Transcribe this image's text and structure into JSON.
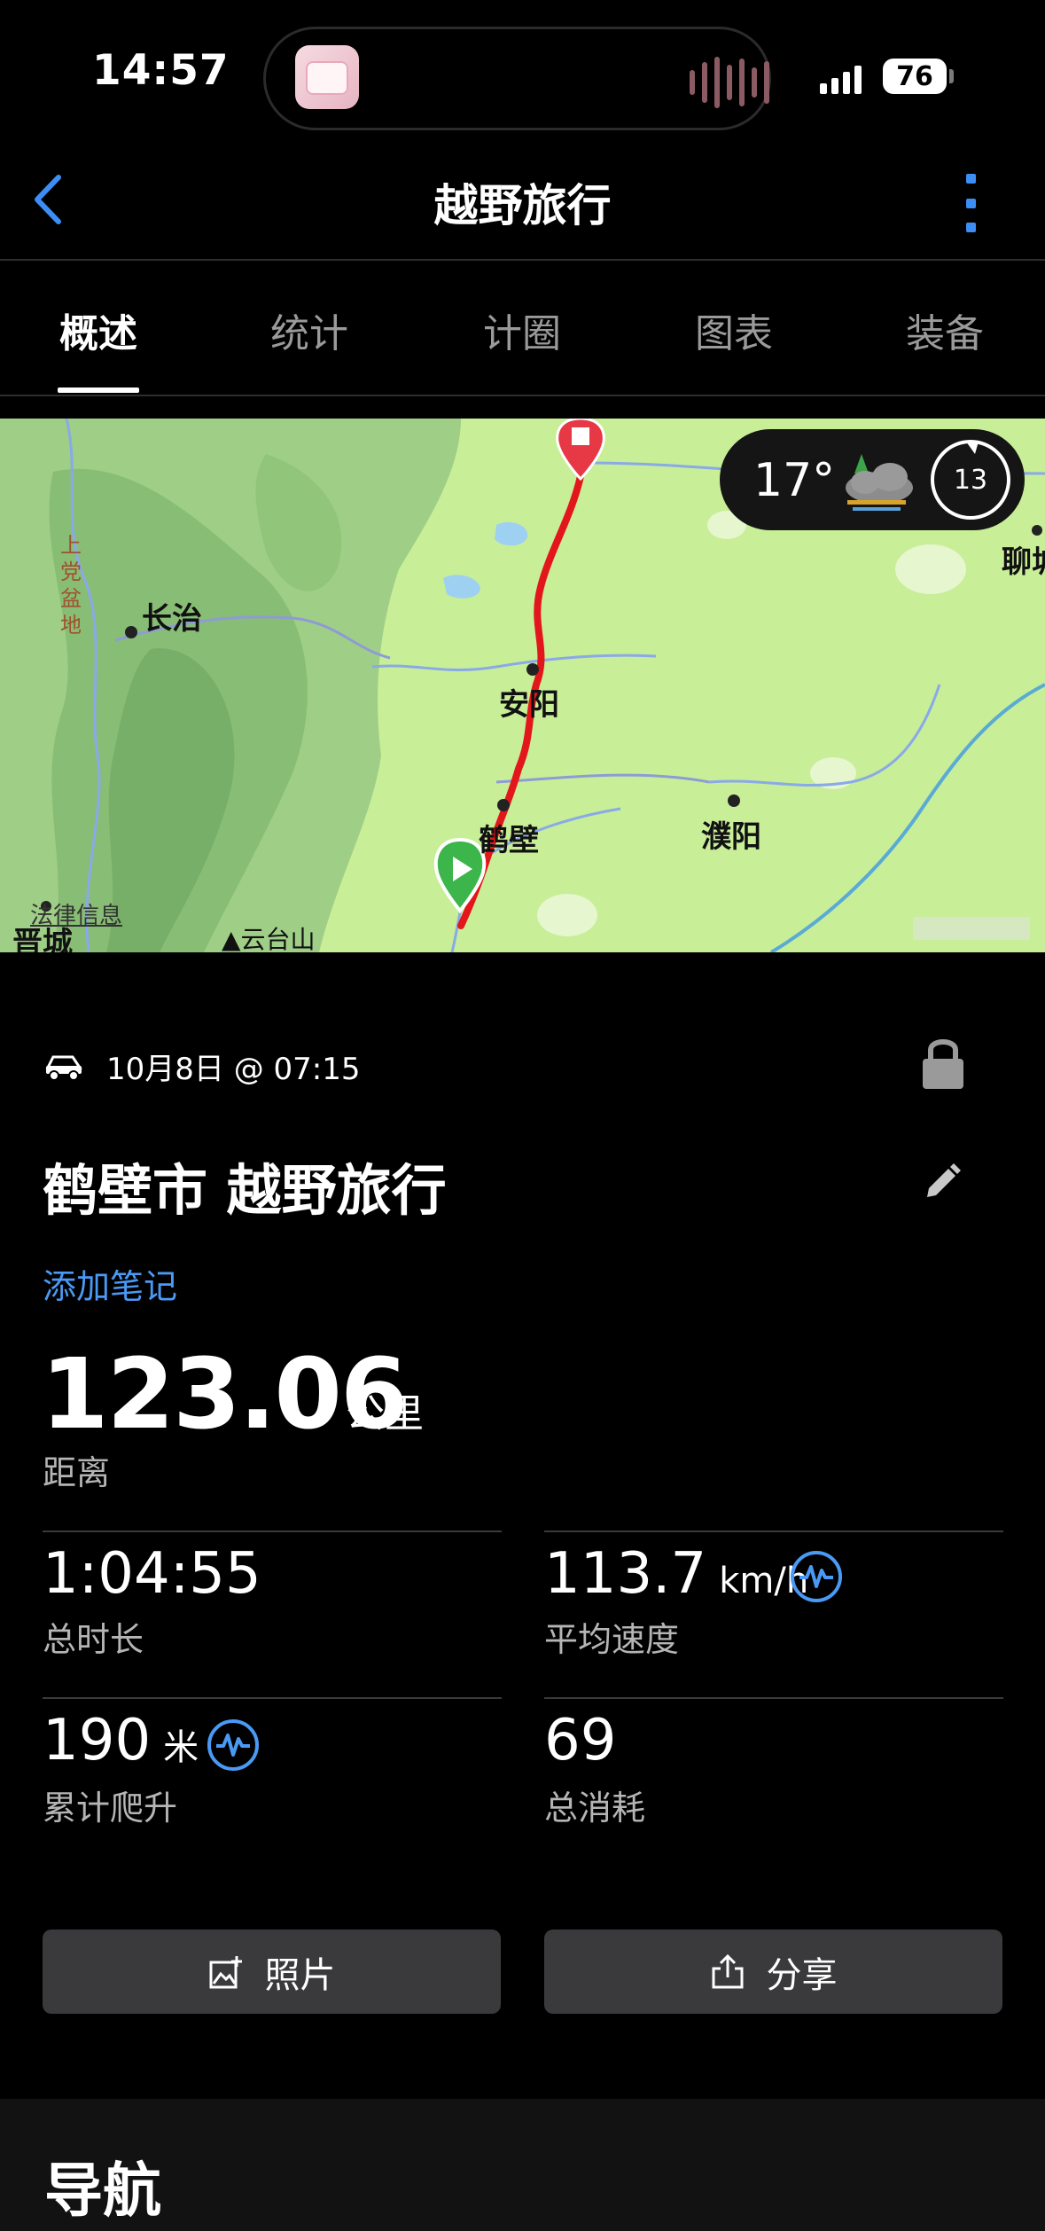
{
  "status_bar": {
    "time": "14:57",
    "battery": "76"
  },
  "header": {
    "title": "越野旅行"
  },
  "tabs": [
    {
      "label": "概述",
      "active": true
    },
    {
      "label": "统计",
      "active": false
    },
    {
      "label": "计圈",
      "active": false
    },
    {
      "label": "图表",
      "active": false
    },
    {
      "label": "装备",
      "active": false
    }
  ],
  "map": {
    "labels": {
      "changzhi": "长治",
      "anyang": "安阳",
      "hebi": "鹤壁",
      "puyang": "濮阳",
      "jincheng": "晋城",
      "yuntaishan": "云台山",
      "liaocheng": "聊城",
      "shangdang": "上党盆地",
      "info": "法律信息"
    },
    "weather": {
      "temp": "17°",
      "dial": "13"
    },
    "route_color": "#e3161b",
    "start_color": "#3cb54a",
    "end_color": "#e63845"
  },
  "activity": {
    "type_icon": "offroad-vehicle-icon",
    "datetime": "10月8日 @ 07:15",
    "title": "鹤壁市 越野旅行",
    "add_note": "添加笔记",
    "distance": {
      "value": "123.06",
      "unit": "公里",
      "label": "距离"
    }
  },
  "stats": {
    "duration": {
      "value": "1:04:55",
      "label": "总时长"
    },
    "avg_speed": {
      "value": "113.7",
      "unit": "km/h",
      "label": "平均速度"
    },
    "elevation": {
      "value": "190",
      "unit": "米",
      "label": "累计爬升"
    },
    "calories": {
      "value": "69",
      "label": "总消耗"
    }
  },
  "buttons": {
    "photo": "照片",
    "share": "分享"
  },
  "section": {
    "title": "导航"
  },
  "colors": {
    "accent": "#4a9af5",
    "button_bg": "#3a3a3c",
    "background": "#000000"
  }
}
